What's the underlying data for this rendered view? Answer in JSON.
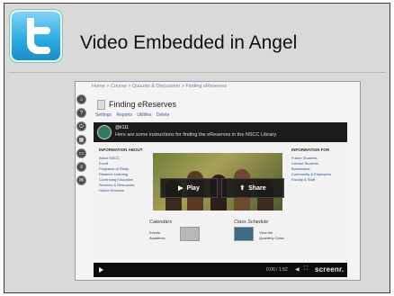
{
  "slide": {
    "title": "Video Embedded in Angel",
    "logo_icon": "twitter-bird-icon",
    "colors": {
      "slide_bg": "#d9d9d9",
      "logo_blue": "#29a9e1"
    }
  },
  "screenshot": {
    "breadcrumb": "Home > Course > Quizzes & Discussion > Finding eReserves",
    "page_heading": "Finding eReserves",
    "page_tabs": [
      "Settings",
      "Reports",
      "Utilities",
      "Delete"
    ],
    "video": {
      "handle": "@it111",
      "description": "Here are some instructions for finding the eReserves in the NSCC Library.",
      "left_column_title": "INFORMATION ABOUT",
      "left_column_items": [
        "About NSCC",
        "Enroll",
        "Programs of Study",
        "Distance Learning",
        "Continuing Education",
        "Services & Resources",
        "Online Services"
      ],
      "right_column_title": "INFORMATION FOR",
      "right_column_items": [
        "Future Students",
        "Current Students",
        "Businesses",
        "Community & Employers",
        "Faculty & Staff"
      ],
      "play_label": "Play",
      "share_label": "Share",
      "calendars_label": "Calendars",
      "events_label": "Events",
      "academic_label": "Academic",
      "class_schedule_label": "Class Schedule",
      "view_label": "View the",
      "quarterly_label": "Quarterly Class",
      "time": "0:00 / 1:52",
      "brand": "screenr."
    }
  }
}
